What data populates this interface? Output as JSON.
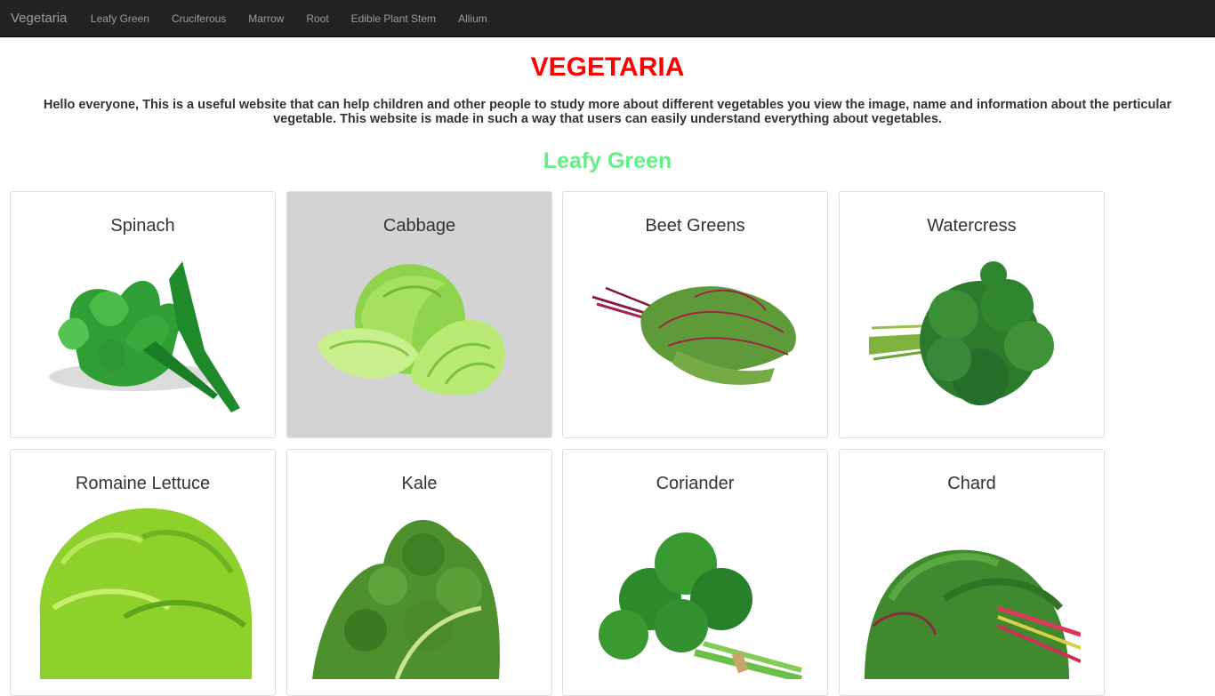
{
  "navbar": {
    "brand": "Vegetaria",
    "items": [
      "Leafy Green",
      "Cruciferous",
      "Marrow",
      "Root",
      "Edible Plant Stem",
      "Allium"
    ]
  },
  "header": {
    "title": "VEGETARIA",
    "intro": "Hello everyone, This is a useful website that can help children and other people to study more about different vegetables you view the image, name and information about the perticular vegetable. This website is made in such a way that users can easily understand everything about vegetables."
  },
  "section": {
    "title": "Leafy Green"
  },
  "cards": [
    {
      "name": "Spinach",
      "image": "spinach-image"
    },
    {
      "name": "Cabbage",
      "image": "cabbage-image"
    },
    {
      "name": "Beet Greens",
      "image": "beet-greens-image"
    },
    {
      "name": "Watercress",
      "image": "watercress-image"
    },
    {
      "name": "Romaine Lettuce",
      "image": "romaine-lettuce-image"
    },
    {
      "name": "Kale",
      "image": "kale-image"
    },
    {
      "name": "Coriander",
      "image": "coriander-image"
    },
    {
      "name": "Chard",
      "image": "chard-image"
    }
  ],
  "colors": {
    "navbar_bg": "#222222",
    "nav_text": "#9d9d9d",
    "title": "#ff0000",
    "section_title": "#61f185",
    "card_hover_bg": "#d3d3d3"
  }
}
